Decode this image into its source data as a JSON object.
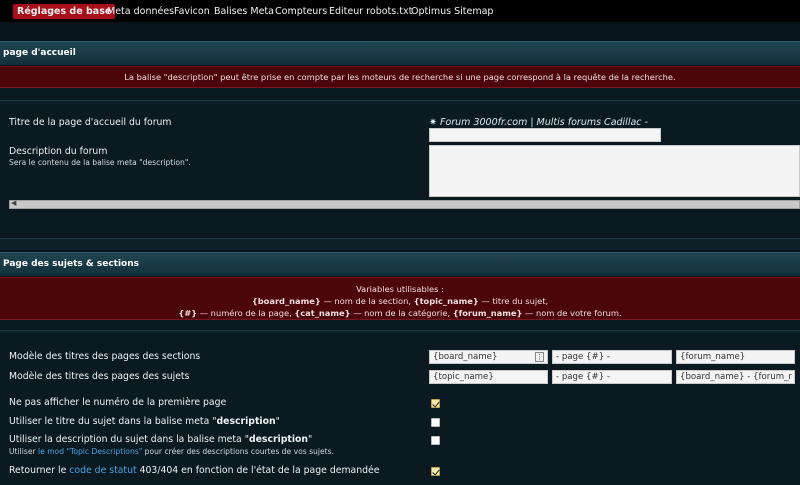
{
  "tabs": [
    {
      "label": "Réglages de base",
      "active": true
    },
    {
      "label": "Meta données",
      "active": false
    },
    {
      "label": "Favicon",
      "active": false
    },
    {
      "label": "Balises Meta",
      "active": false
    },
    {
      "label": "Compteurs",
      "active": false
    },
    {
      "label": "Editeur robots.txt",
      "active": false
    },
    {
      "label": "Optimus Sitemap",
      "active": false
    }
  ],
  "home": {
    "header": "page d'accueil",
    "banner": "La balise \"description\" peut être prise en compte par les moteurs de recherche si une page correspond à la requête de la recherche.",
    "title_label": "Titre de la page d'accueil du forum",
    "title_value": "✷ Forum 3000fr.com | Multis forums Cadillac -",
    "title_input_value": "",
    "desc_label": "Description du forum",
    "desc_sublabel": "Sera le contenu de la balise meta \"description\".",
    "desc_value": ""
  },
  "topics": {
    "header": "Page des sujets & sections",
    "vars_title": "Variables utilisables :",
    "vars_line1": {
      "v1": "{board_name}",
      "t1": " — nom de la section, ",
      "v2": "{topic_name}",
      "t2": " — titre du sujet,"
    },
    "vars_line2": {
      "v1": "{#}",
      "t1": " — numéro de la page, ",
      "v2": "{cat_name}",
      "t2": " — nom de la catégorie, ",
      "v3": "{forum_name}",
      "t3": " — nom de votre forum."
    },
    "sections_label": "Modèle des titres des pages des sections",
    "sections_fields": [
      "{board_name}",
      "- page {#} -",
      "{forum_name}"
    ],
    "subjects_label": "Modèle des titres des pages des sujets",
    "subjects_fields": [
      "{topic_name}",
      "- page {#} -",
      "{board_name} - {forum_r"
    ],
    "options": [
      {
        "label": "Ne pas afficher le numéro de la première page",
        "checked": true
      },
      {
        "label_pre": "Utiliser le titre du sujet dans la balise meta \"",
        "label_bold": "description",
        "label_post": "\"",
        "checked": false
      },
      {
        "label_pre": "Utiliser la description du sujet dans la balise meta \"",
        "label_bold": "description",
        "label_post": "\"",
        "sub_pre": "Utiliser ",
        "sub_link": "le mod \"Topic Descriptions\"",
        "sub_post": " pour créer des descriptions courtes de vos sujets.",
        "checked": false
      },
      {
        "label_pre": "Retourner le ",
        "label_link": "code de statut",
        "label_post": " 403/404 en fonction de l'état de la page demandée",
        "checked": true
      }
    ]
  },
  "colors": {
    "accent_tab": "#a80f1a",
    "banner_bg": "#4b050b",
    "link": "#4aa3e4"
  }
}
